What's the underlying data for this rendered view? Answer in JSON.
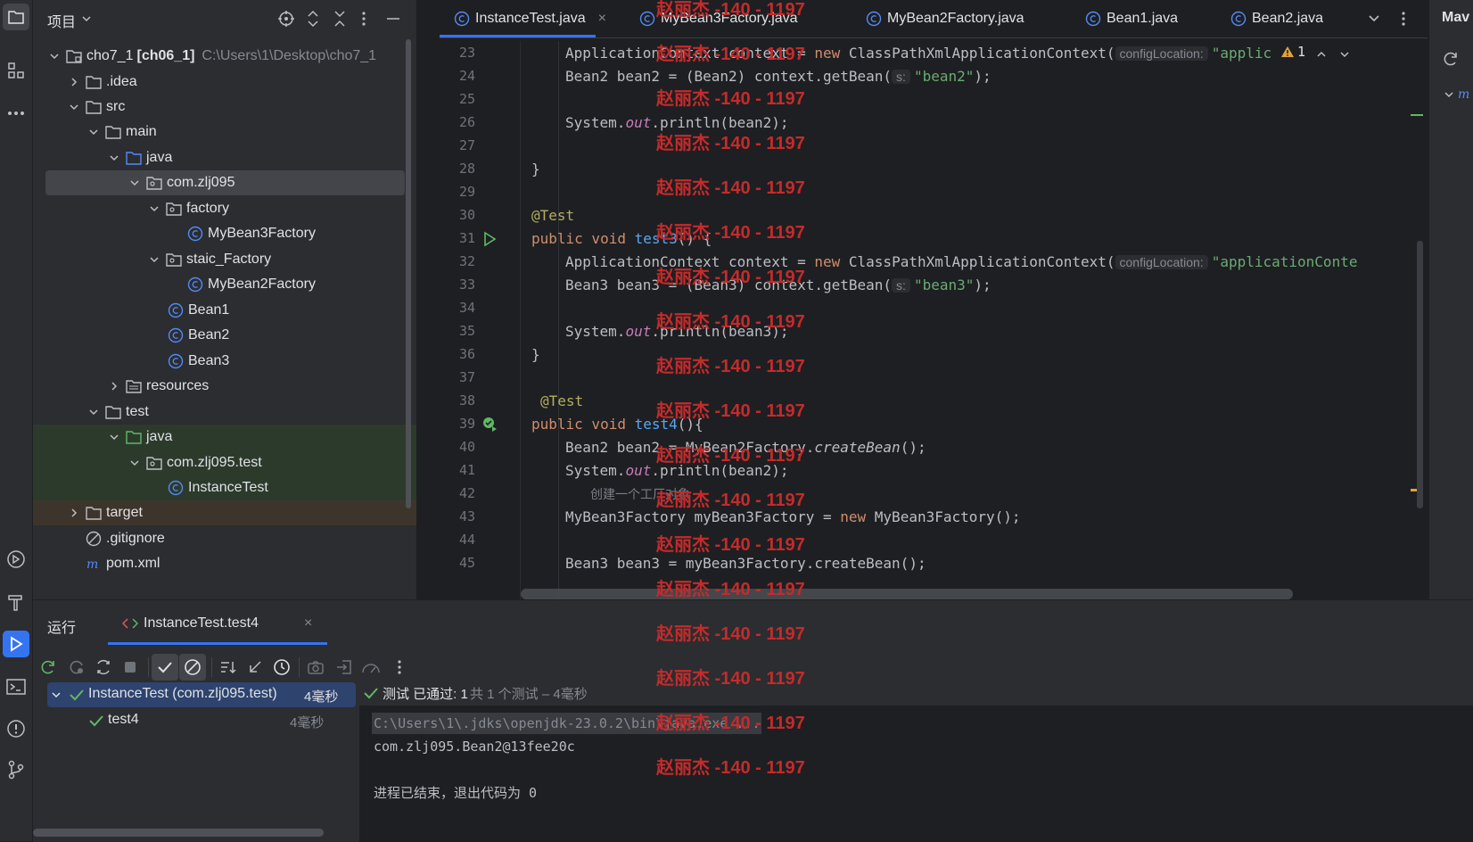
{
  "project": {
    "title": "项目",
    "tree": [
      {
        "label": "cho7_1",
        "bold": "[ch06_1]",
        "path": "C:\\Users\\1\\Desktop\\cho7_1"
      },
      {
        "label": ".idea"
      },
      {
        "label": "src"
      },
      {
        "label": "main"
      },
      {
        "label": "java"
      },
      {
        "label": "com.zlj095"
      },
      {
        "label": "factory"
      },
      {
        "label": "MyBean3Factory"
      },
      {
        "label": "staic_Factory"
      },
      {
        "label": "MyBean2Factory"
      },
      {
        "label": "Bean1"
      },
      {
        "label": "Bean2"
      },
      {
        "label": "Bean3"
      },
      {
        "label": "resources"
      },
      {
        "label": "test"
      },
      {
        "label": "java"
      },
      {
        "label": "com.zlj095.test"
      },
      {
        "label": "InstanceTest"
      },
      {
        "label": "target"
      },
      {
        "label": ".gitignore"
      },
      {
        "label": "pom.xml"
      }
    ]
  },
  "tabs": [
    {
      "label": "InstanceTest.java",
      "close": "×"
    },
    {
      "label": "MyBean3Factory.java"
    },
    {
      "label": "MyBean2Factory.java"
    },
    {
      "label": "Bean1.java"
    },
    {
      "label": "Bean2.java"
    }
  ],
  "editor": {
    "line_numbers": [
      "23",
      "24",
      "25",
      "26",
      "27",
      "28",
      "29",
      "30",
      "31",
      "32",
      "33",
      "34",
      "35",
      "36",
      "37",
      "38",
      "39",
      "40",
      "41",
      "42",
      "43",
      "44",
      "45"
    ],
    "warning_count": "1",
    "hints": {
      "config": "configLocation:",
      "s": "s:"
    },
    "strings": {
      "l23": "\"applic",
      "l24": "\"bean2\"",
      "l32": "\"applicationConte",
      "l33": "\"bean3\""
    },
    "code": {
      "l23a": "ApplicationContext context = ",
      "l23b": "new",
      "l23c": " ClassPathXmlApplicationContext(",
      "l24a": "Bean2 bean2 = (Bean2) context.getBean(",
      "l24b": ");",
      "l26a": "System.",
      "l26b": "out",
      "l26c": ".println(bean2);",
      "l28": "}",
      "l30": "@Test",
      "l31a": "public void ",
      "l31b": "test3",
      "l31c": "() {",
      "l32a": "ApplicationContext context = ",
      "l32b": "new",
      "l32c": " ClassPathXmlApplicationContext(",
      "l33a": "Bean3 bean3 = (Bean3) context.getBean(",
      "l33b": ");",
      "l35a": "System.",
      "l35b": "out",
      "l35c": ".println(bean3);",
      "l36": "}",
      "l38": "@Test",
      "l39a": "public void ",
      "l39b": "test4",
      "l39c": "(){",
      "l40a": "Bean2 bean2 = MyBean2Factory.",
      "l40b": "createBean",
      "l40c": "();",
      "l41a": "System.",
      "l41b": "out",
      "l41c": ".println(bean2);",
      "l42a": "//",
      "l42b": "创建一个工厂对象",
      "l43a": "MyBean3Factory myBean3Factory = ",
      "l43b": "new",
      "l43c": " MyBean3Factory();",
      "l45": "Bean3 bean3 = myBean3Factory.createBean();"
    }
  },
  "watermark": "赵丽杰 -140 - 1197",
  "right_panel": {
    "title": "Mav"
  },
  "run": {
    "tab_label": "运行",
    "config_tab": "InstanceTest.test4",
    "close": "×",
    "tree": {
      "root_label": "InstanceTest (com.zlj095.test)",
      "root_time": "4毫秒",
      "child_label": "test4",
      "child_time": "4毫秒"
    },
    "status": {
      "passed": "测试 已通过: 1",
      "detail": "共 1 个测试 – 4毫秒"
    },
    "console": [
      "C:\\Users\\1\\.jdks\\openjdk-23.0.2\\bin\\java.exe ...",
      "com.zlj095.Bean2@13fee20c",
      "",
      "进程已结束，退出代码为 0"
    ]
  },
  "colors": {
    "accent": "#3574f0",
    "watermark": "#c42b2b",
    "pass": "#5fb865"
  }
}
